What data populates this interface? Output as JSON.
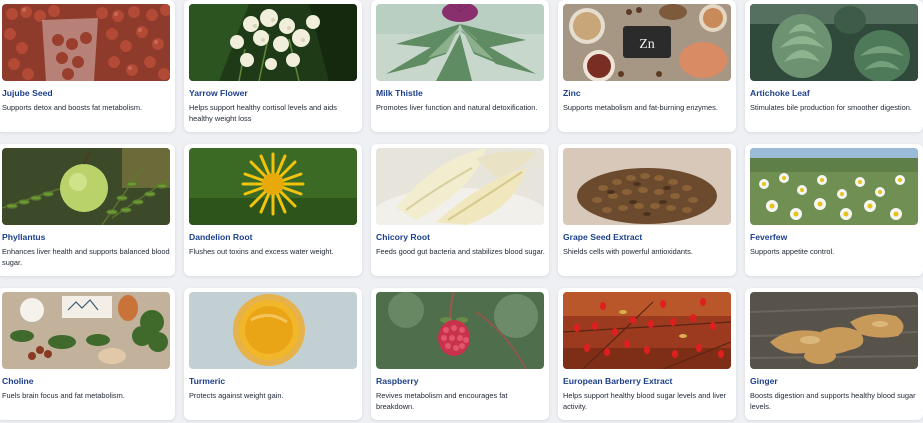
{
  "cards": [
    {
      "title": "Jujube Seed",
      "description": "Supports detox and boosts fat metabolism.",
      "image_icon": "jujube-seed-image"
    },
    {
      "title": "Yarrow Flower",
      "description": "Helps support healthy cortisol levels and aids healthy weight loss",
      "image_icon": "yarrow-flower-image"
    },
    {
      "title": "Milk Thistle",
      "description": "Promotes liver function and natural detoxification.",
      "image_icon": "milk-thistle-image"
    },
    {
      "title": "Zinc",
      "description": "Supports metabolism and fat-burning enzymes.",
      "image_icon": "zinc-image",
      "image_text": "Zn"
    },
    {
      "title": "Artichoke Leaf",
      "description": "Stimulates bile production for smoother digestion.",
      "image_icon": "artichoke-leaf-image"
    },
    {
      "title": "Phyllantus",
      "description": "Enhances liver health and supports balanced blood sugar.",
      "image_icon": "phyllantus-image"
    },
    {
      "title": "Dandelion Root",
      "description": "Flushes out toxins and excess water weight.",
      "image_icon": "dandelion-root-image"
    },
    {
      "title": "Chicory Root",
      "description": "Feeds good gut bacteria and stabilizes blood sugar.",
      "image_icon": "chicory-root-image"
    },
    {
      "title": "Grape Seed Extract",
      "description": "Shields cells with powerful antioxidants.",
      "image_icon": "grape-seed-image"
    },
    {
      "title": "Feverfew",
      "description": "Supports appetite control.",
      "image_icon": "feverfew-image"
    },
    {
      "title": "Choline",
      "description": "Fuels brain focus and fat metabolism.",
      "image_icon": "choline-image"
    },
    {
      "title": "Turmeric",
      "description": "Protects against weight gain.",
      "image_icon": "turmeric-image"
    },
    {
      "title": "Raspberry",
      "description": "Revives metabolism and encourages fat breakdown.",
      "image_icon": "raspberry-image"
    },
    {
      "title": "European Barberry Extract",
      "description": "Helps support healthy blood sugar levels and liver activity.",
      "image_icon": "barberry-image"
    },
    {
      "title": "Ginger",
      "description": "Boosts digestion and supports healthy blood sugar levels.",
      "image_icon": "ginger-image"
    }
  ],
  "colors": {
    "background": "#eef0f4",
    "card": "#ffffff",
    "title": "#1c3f8c",
    "text": "#222a38"
  }
}
